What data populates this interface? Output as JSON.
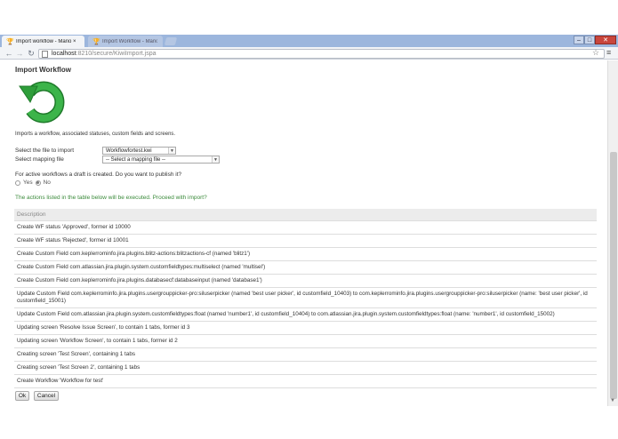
{
  "browser": {
    "tabs": [
      {
        "label": "Import workflow - Mario ×",
        "active": true
      },
      {
        "label": "Import Workflow - Mario.bu (L)",
        "active": false
      }
    ],
    "window_controls": {
      "minimize": "–",
      "maximize": "□",
      "close": "✕"
    },
    "url": {
      "host": "localhost",
      "path": ":8210/secure/KiwiImport.jspa"
    }
  },
  "page": {
    "title": "Import Workflow",
    "intro": "Imports a workflow, associated statuses, custom fields and screens.",
    "file_label": "Select the file to import",
    "file_value": "Workflowfortest.kwi",
    "mapping_label": "Select mapping file",
    "mapping_value": "-- Select a mapping file --",
    "publish_question": "For active workflows a draft is created. Do you want to publish it?",
    "publish_yes": "Yes",
    "publish_no": "No",
    "publish_selected": "No",
    "notice": "The actions listed in the table below will be executed. Proceed with import?",
    "table_header": "Description",
    "rows": [
      "Create WF status 'Approved', former id 10000",
      "Create WF status 'Rejected', former id 10001",
      "Create Custom Field com.keplerrominfo.jira.plugins.blitz-actions:blitzactions-cf (named 'blitz1')",
      "Create Custom Field com.atlassian.jira.plugin.system.customfieldtypes:multiselect (named 'multisel')",
      "Create Custom Field com.keplerrominfo.jira.plugins.databasecf:databaseinput (named 'database1')",
      "Update Custom Field com.keplerrominfo.jira.plugins.usergrouppicker-pro:siluserpicker (named 'best user picker', id customfield_10403) to com.keplerrominfo.jira.plugins.usergrouppicker-pro:siluserpicker (name: 'best user picker', id customfield_15001)",
      "Update Custom Field com.atlassian.jira.plugin.system.customfieldtypes:float (named 'number1', id customfield_10404) to com.atlassian.jira.plugin.system.customfieldtypes:float (name: 'number1', id customfield_15002)",
      "Updating screen 'Resolve Issue Screen', to contain 1 tabs, former id 3",
      "Updating screen 'Workflow Screen', to contain 1 tabs, former id 2",
      "Creating screen 'Test Screen', containing 1 tabs",
      "Creating screen 'Test Screen 2', containing 1 tabs",
      "Create Workflow 'Workflow for test'"
    ],
    "ok_label": "Ok",
    "cancel_label": "Cancel"
  },
  "colors": {
    "logo": "#2e9e3a",
    "notice": "#3a8a3a",
    "tab_strip": "#9cb6dd"
  },
  "icons": {
    "back": "back-icon",
    "forward": "forward-icon",
    "reload": "reload-icon",
    "star": "star-icon",
    "menu": "menu-icon",
    "logo": "workflow-import-icon"
  }
}
